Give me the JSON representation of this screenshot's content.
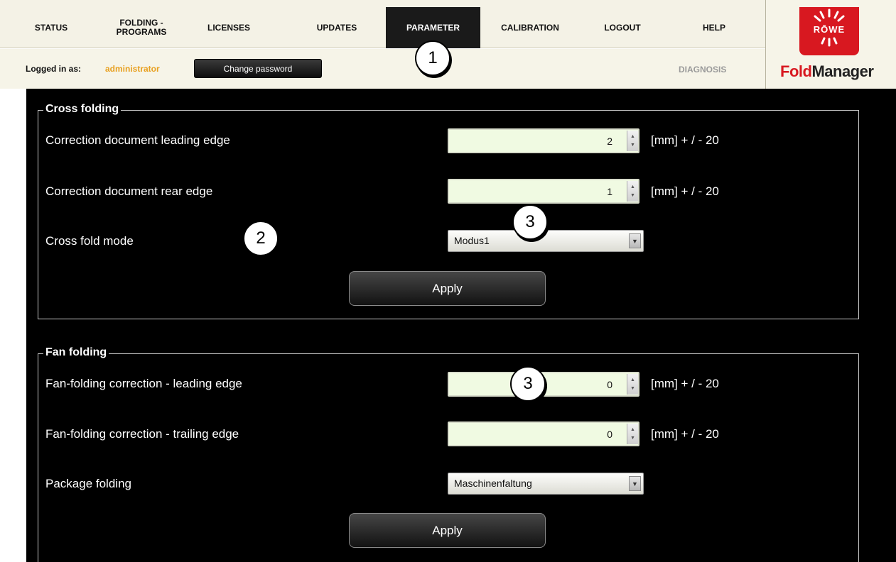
{
  "nav": {
    "items": [
      {
        "label": "STATUS"
      },
      {
        "label": "FOLDING -\nPROGRAMS"
      },
      {
        "label": "LICENSES"
      },
      {
        "label": "UPDATES"
      },
      {
        "label": "PARAMETER"
      },
      {
        "label": "CALIBRATION"
      },
      {
        "label": "LOGOUT"
      },
      {
        "label": "HELP"
      }
    ],
    "active": "PARAMETER"
  },
  "user": {
    "logged_in_label": "Logged in as:",
    "username": "administrator",
    "change_password_label": "Change password",
    "diagnosis_label": "DIAGNOSIS"
  },
  "logo": {
    "brand": "RŌWE",
    "product_fold": "Fold",
    "product_manager": "Manager"
  },
  "cross_folding": {
    "legend": "Cross folding",
    "leading_edge": {
      "label": "Correction document leading edge",
      "value": "2",
      "unit": "[mm]  + / - 20"
    },
    "rear_edge": {
      "label": "Correction document rear edge",
      "value": "1",
      "unit": "[mm]  + / - 20"
    },
    "mode": {
      "label": "Cross fold mode",
      "selected": "Modus1"
    },
    "apply_label": "Apply"
  },
  "fan_folding": {
    "legend": "Fan folding",
    "leading_edge": {
      "label": "Fan-folding correction - leading edge",
      "value": "0",
      "unit": "[mm]  + / - 20"
    },
    "trailing_edge": {
      "label": "Fan-folding correction - trailing edge",
      "value": "0",
      "unit": "[mm]  + / - 20"
    },
    "package": {
      "label": "Package folding",
      "selected": "Maschinenfaltung"
    },
    "apply_label": "Apply"
  },
  "callouts": [
    "1",
    "2",
    "3",
    "3"
  ],
  "colors": {
    "header_bg": "#f4f2e6",
    "active_tab": "#1a1a1a",
    "username": "#e8a020",
    "brand_red": "#d81820",
    "input_bg": "#f0fae2"
  },
  "icons": [
    "spin-up-icon",
    "spin-down-icon",
    "dropdown-arrow-icon",
    "rowe-logo-icon"
  ]
}
